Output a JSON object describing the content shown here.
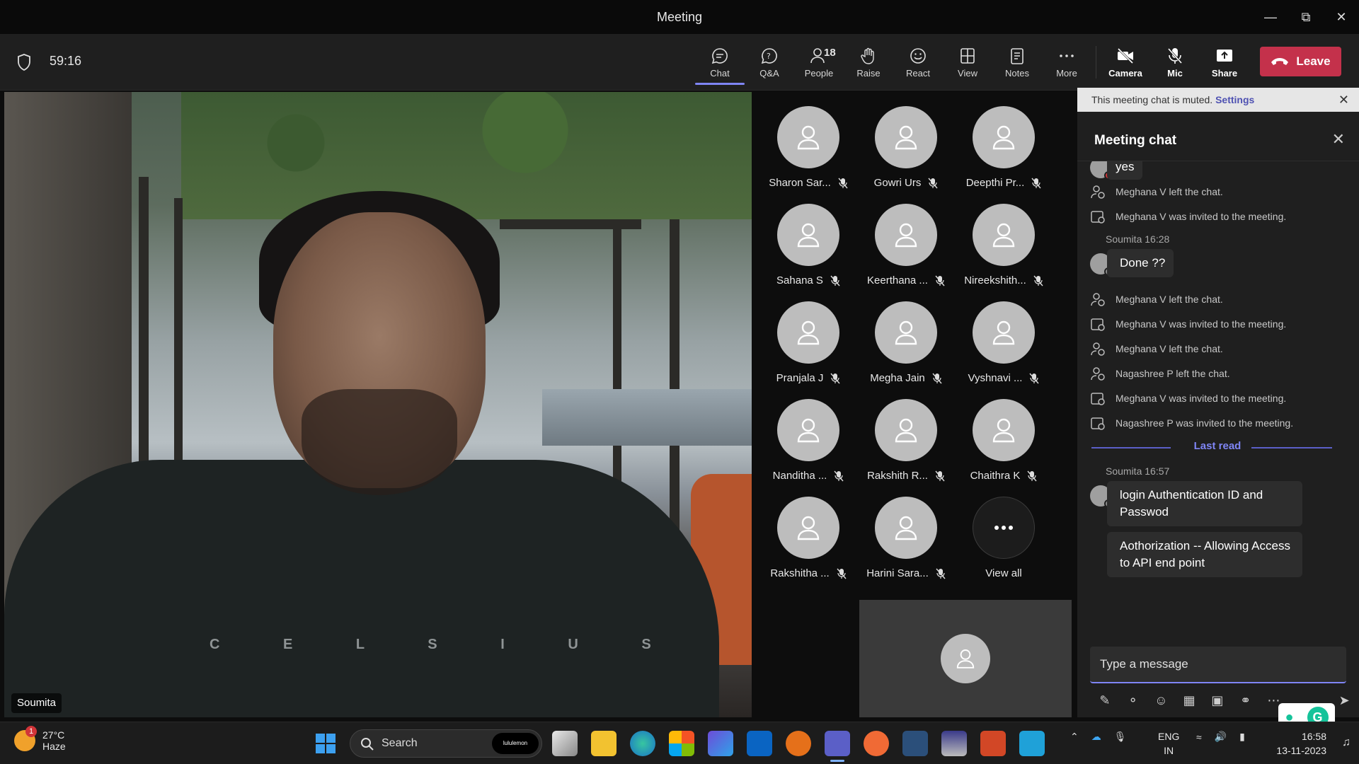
{
  "window": {
    "title": "Meeting"
  },
  "toolbar": {
    "timer": "59:16",
    "tools": [
      {
        "label": "Chat",
        "icon": "chat-icon"
      },
      {
        "label": "Q&A",
        "icon": "qa-icon"
      },
      {
        "label": "People",
        "icon": "people-icon",
        "count": "18"
      },
      {
        "label": "Raise",
        "icon": "raise-hand-icon"
      },
      {
        "label": "React",
        "icon": "react-icon"
      },
      {
        "label": "View",
        "icon": "view-icon"
      },
      {
        "label": "Notes",
        "icon": "notes-icon"
      },
      {
        "label": "More",
        "icon": "more-icon"
      }
    ],
    "devices": [
      {
        "label": "Camera",
        "icon": "camera-off-icon"
      },
      {
        "label": "Mic",
        "icon": "mic-off-icon"
      },
      {
        "label": "Share",
        "icon": "share-icon"
      }
    ],
    "leave_label": "Leave"
  },
  "video": {
    "speaker_name": "Soumita",
    "shirt_text": "C E L S I U S"
  },
  "participants": [
    {
      "name": "Sharon Sar..."
    },
    {
      "name": "Gowri Urs"
    },
    {
      "name": "Deepthi Pr..."
    },
    {
      "name": "Sahana S"
    },
    {
      "name": "Keerthana ..."
    },
    {
      "name": "Nireekshith..."
    },
    {
      "name": "Pranjala J"
    },
    {
      "name": "Megha Jain"
    },
    {
      "name": "Vyshnavi ..."
    },
    {
      "name": "Nanditha ..."
    },
    {
      "name": "Rakshith R..."
    },
    {
      "name": "Chaithra K"
    },
    {
      "name": "Rakshitha ..."
    },
    {
      "name": "Harini Sara..."
    }
  ],
  "view_all_label": "View all",
  "chat": {
    "muted_notice": "This meeting chat is muted.",
    "muted_link": "Settings",
    "title": "Meeting chat",
    "top_bubble": "yes",
    "sys1": "Meghana V left the chat.",
    "sys2": "Meghana V was invited to the meeting.",
    "meta1": "Soumita  16:28",
    "bubble1": "Done ??",
    "sys3": "Meghana V left the chat.",
    "sys4": "Meghana V was invited to the meeting.",
    "sys5": "Meghana V left the chat.",
    "sys6": "Nagashree P left the chat.",
    "sys7": "Meghana V was invited to the meeting.",
    "sys8": "Nagashree P was invited to the meeting.",
    "last_read": "Last read",
    "meta2": "Soumita  16:57",
    "bubble2": "login Authentication ID and Passwod",
    "bubble3": "Aothorization -- Allowing Access to API end point",
    "compose_placeholder": "Type a message"
  },
  "taskbar": {
    "temp": "27°C",
    "weather": "Haze",
    "weather_badge": "1",
    "search_label": "Search",
    "search_pill": "lululemon",
    "lang1": "ENG",
    "lang2": "IN",
    "time": "16:58",
    "date": "13-11-2023"
  },
  "colors": {
    "accent": "#7f85f5",
    "leave": "#c4314b",
    "background": "#1f1f1f"
  }
}
